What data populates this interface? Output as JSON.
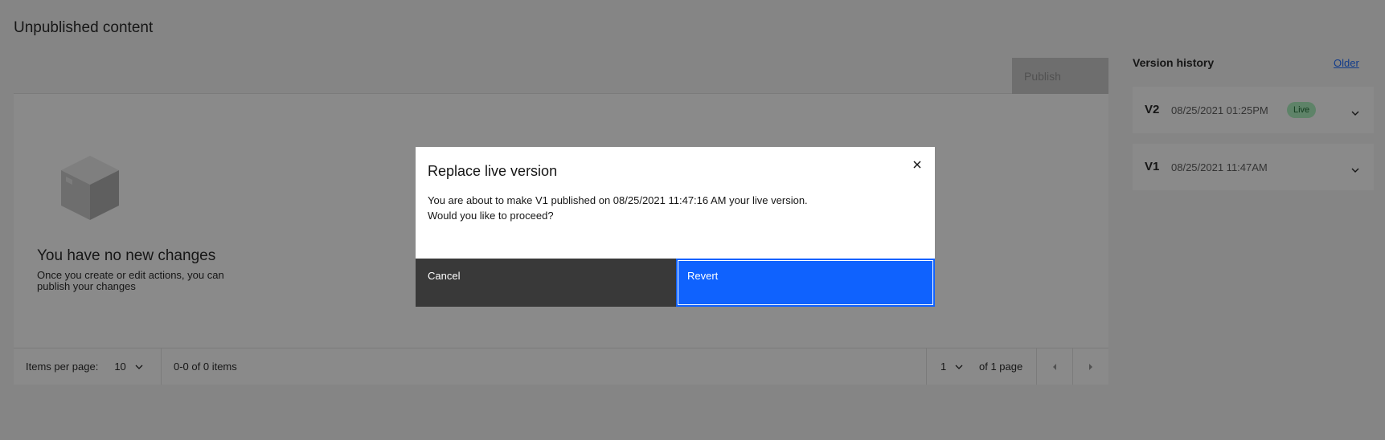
{
  "page": {
    "title": "Unpublished content"
  },
  "table": {
    "publish_label": "Publish",
    "empty_title": "You have no new changes",
    "empty_description": "Once you create or edit actions, you can publish your changes",
    "pagination": {
      "items_per_page_label": "Items per page:",
      "items_per_page_value": "10",
      "range_text": "0-0 of 0 items",
      "page_value": "1",
      "page_of_text": "of 1 page"
    }
  },
  "version_history": {
    "title": "Version history",
    "older_link": "Older",
    "items": [
      {
        "version": "V2",
        "date": "08/25/2021 01:25PM",
        "badge": "Live"
      },
      {
        "version": "V1",
        "date": "08/25/2021 11:47AM",
        "badge": ""
      }
    ]
  },
  "modal": {
    "title": "Replace live version",
    "body_line1": "You are about to make V1 published on 08/25/2021 11:47:16 AM your live version.",
    "body_line2": "Would you like to proceed?",
    "cancel_label": "Cancel",
    "revert_label": "Revert"
  },
  "colors": {
    "primary": "#0f62fe",
    "secondary_button": "#393939",
    "live_badge_bg": "#a7f0ba",
    "overlay": "rgba(22,22,22,0.5)"
  },
  "icons": {
    "empty_state": "box-icon",
    "close": "close-icon",
    "dropdown": "chevron-down-icon",
    "prev": "caret-left-icon",
    "next": "caret-right-icon"
  }
}
